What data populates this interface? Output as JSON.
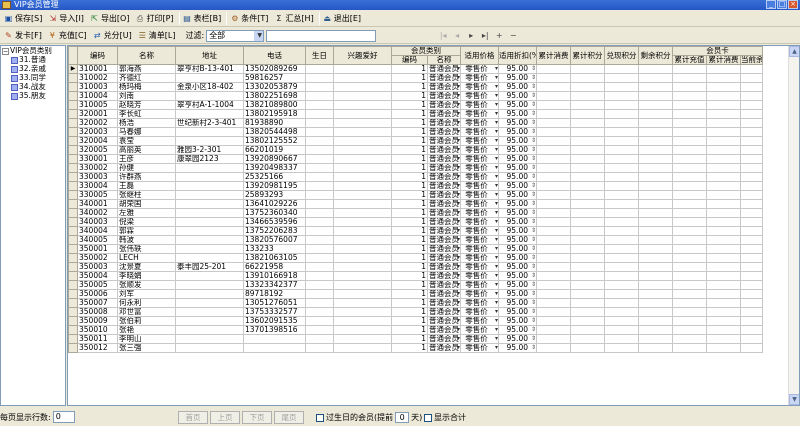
{
  "window": {
    "title": "VIP会员管理"
  },
  "toolbar1": {
    "buttons": [
      {
        "icon": "save-icon",
        "label": "保存[S]"
      },
      {
        "icon": "import-icon",
        "label": "导入[I]"
      },
      {
        "icon": "export-icon",
        "label": "导出[O]"
      },
      {
        "icon": "print-icon",
        "label": "打印[P]"
      },
      {
        "icon": "columns-icon",
        "label": "表栏[B]"
      },
      {
        "icon": "condition-icon",
        "label": "条件[T]"
      },
      {
        "icon": "sum-icon",
        "label": "汇总[H]"
      },
      {
        "icon": "exit-icon",
        "label": "退出[E]"
      }
    ]
  },
  "toolbar2": {
    "buttons": [
      {
        "icon": "issue-card-icon",
        "label": "发卡[F]"
      },
      {
        "icon": "recharge-icon",
        "label": "充值[C]"
      },
      {
        "icon": "redeem-icon",
        "label": "兑分[U]"
      },
      {
        "icon": "clear-icon",
        "label": "清单[L]"
      }
    ],
    "filter_label": "过滤:",
    "filter_value": "全部",
    "search_value": "",
    "nav": [
      "|◂",
      "◂",
      "▸",
      "▸|",
      "+",
      "−"
    ]
  },
  "tree": {
    "root": "VIP会员类别",
    "children": [
      "31.普通",
      "32.亲戚",
      "33.同学",
      "34.战友",
      "35.朋友"
    ]
  },
  "grid": {
    "headers_top": {
      "member_group": "会员类别",
      "card_group": "会员卡"
    },
    "columns": [
      "编码",
      "名称",
      "地址",
      "电话",
      "生日",
      "兴趣爱好",
      "编码",
      "名称",
      "适用价格",
      "适用折扣(%)",
      "累计消费",
      "累计积分",
      "兑现积分",
      "剩余积分",
      "累计充值",
      "累计消费",
      "当前余"
    ],
    "rows": [
      {
        "code": "310001",
        "name": "郭海燕",
        "addr": "翠亨村B-13-401",
        "phone": "13502089269"
      },
      {
        "code": "310002",
        "name": "齐德红",
        "addr": "",
        "phone": "59816257"
      },
      {
        "code": "310003",
        "name": "杨玛梅",
        "addr": "金泉小区18-402",
        "phone": "13302053879"
      },
      {
        "code": "310004",
        "name": "刘南",
        "addr": "",
        "phone": "13802251698"
      },
      {
        "code": "310005",
        "name": "赵晓芳",
        "addr": "翠亨村A-1-1004",
        "phone": "13821089800"
      },
      {
        "code": "320001",
        "name": "李长虹",
        "addr": "",
        "phone": "13802195918"
      },
      {
        "code": "320002",
        "name": "杨浩",
        "addr": "世纪新村2-3-401",
        "phone": "81938890"
      },
      {
        "code": "320003",
        "name": "马春娜",
        "addr": "",
        "phone": "13820544498"
      },
      {
        "code": "320004",
        "name": "袁莹",
        "addr": "",
        "phone": "13802125552"
      },
      {
        "code": "320005",
        "name": "高丽英",
        "addr": "雅园3-2-301",
        "phone": "66201019"
      },
      {
        "code": "330001",
        "name": "王彦",
        "addr": "康翠园2123",
        "phone": "13920890667"
      },
      {
        "code": "330002",
        "name": "孙健",
        "addr": "",
        "phone": "13920498337"
      },
      {
        "code": "330003",
        "name": "许群燕",
        "addr": "",
        "phone": "25325166"
      },
      {
        "code": "330004",
        "name": "王磊",
        "addr": "",
        "phone": "13920981195"
      },
      {
        "code": "330005",
        "name": "张继柱",
        "addr": "",
        "phone": "25893293"
      },
      {
        "code": "340001",
        "name": "胡荣国",
        "addr": "",
        "phone": "13641029226"
      },
      {
        "code": "340002",
        "name": "左雅",
        "addr": "",
        "phone": "13752360340"
      },
      {
        "code": "340003",
        "name": "倪梁",
        "addr": "",
        "phone": "13466539596"
      },
      {
        "code": "340004",
        "name": "郭霖",
        "addr": "",
        "phone": "13752206283"
      },
      {
        "code": "340005",
        "name": "韩波",
        "addr": "",
        "phone": "13820576007"
      },
      {
        "code": "350001",
        "name": "张伟轶",
        "addr": "",
        "phone": "133233"
      },
      {
        "code": "350002",
        "name": "LECH",
        "addr": "",
        "phone": "13821063105"
      },
      {
        "code": "350003",
        "name": "沈景夏",
        "addr": "泰丰园25-201",
        "phone": "66221958"
      },
      {
        "code": "350004",
        "name": "李晓娟",
        "addr": "",
        "phone": "13910166918"
      },
      {
        "code": "350005",
        "name": "张顺发",
        "addr": "",
        "phone": "13323342377"
      },
      {
        "code": "350006",
        "name": "刘军",
        "addr": "",
        "phone": "89718192"
      },
      {
        "code": "350007",
        "name": "何永利",
        "addr": "",
        "phone": "13051276051"
      },
      {
        "code": "350008",
        "name": "邓世富",
        "addr": "",
        "phone": "13753332577"
      },
      {
        "code": "350009",
        "name": "张伯莉",
        "addr": "",
        "phone": "13602091535"
      },
      {
        "code": "350010",
        "name": "张艳",
        "addr": "",
        "phone": "13701398516"
      },
      {
        "code": "350011",
        "name": "李明山",
        "addr": "",
        "phone": ""
      },
      {
        "code": "350012",
        "name": "张三强",
        "addr": "",
        "phone": ""
      }
    ],
    "row_defaults": {
      "class_code": "1",
      "class_name": "普通会员",
      "price": "零售价",
      "discount": "95.00"
    }
  },
  "footer": {
    "rows_per_page_label": "每页显示行数:",
    "rows_per_page": "0",
    "pager": [
      "首页",
      "上页",
      "下页",
      "尾页"
    ],
    "birthday_check_label_pre": "过生日的会员(提前",
    "birthday_days": "0",
    "birthday_check_label_post": "天)",
    "show_total_label": "显示合计"
  }
}
